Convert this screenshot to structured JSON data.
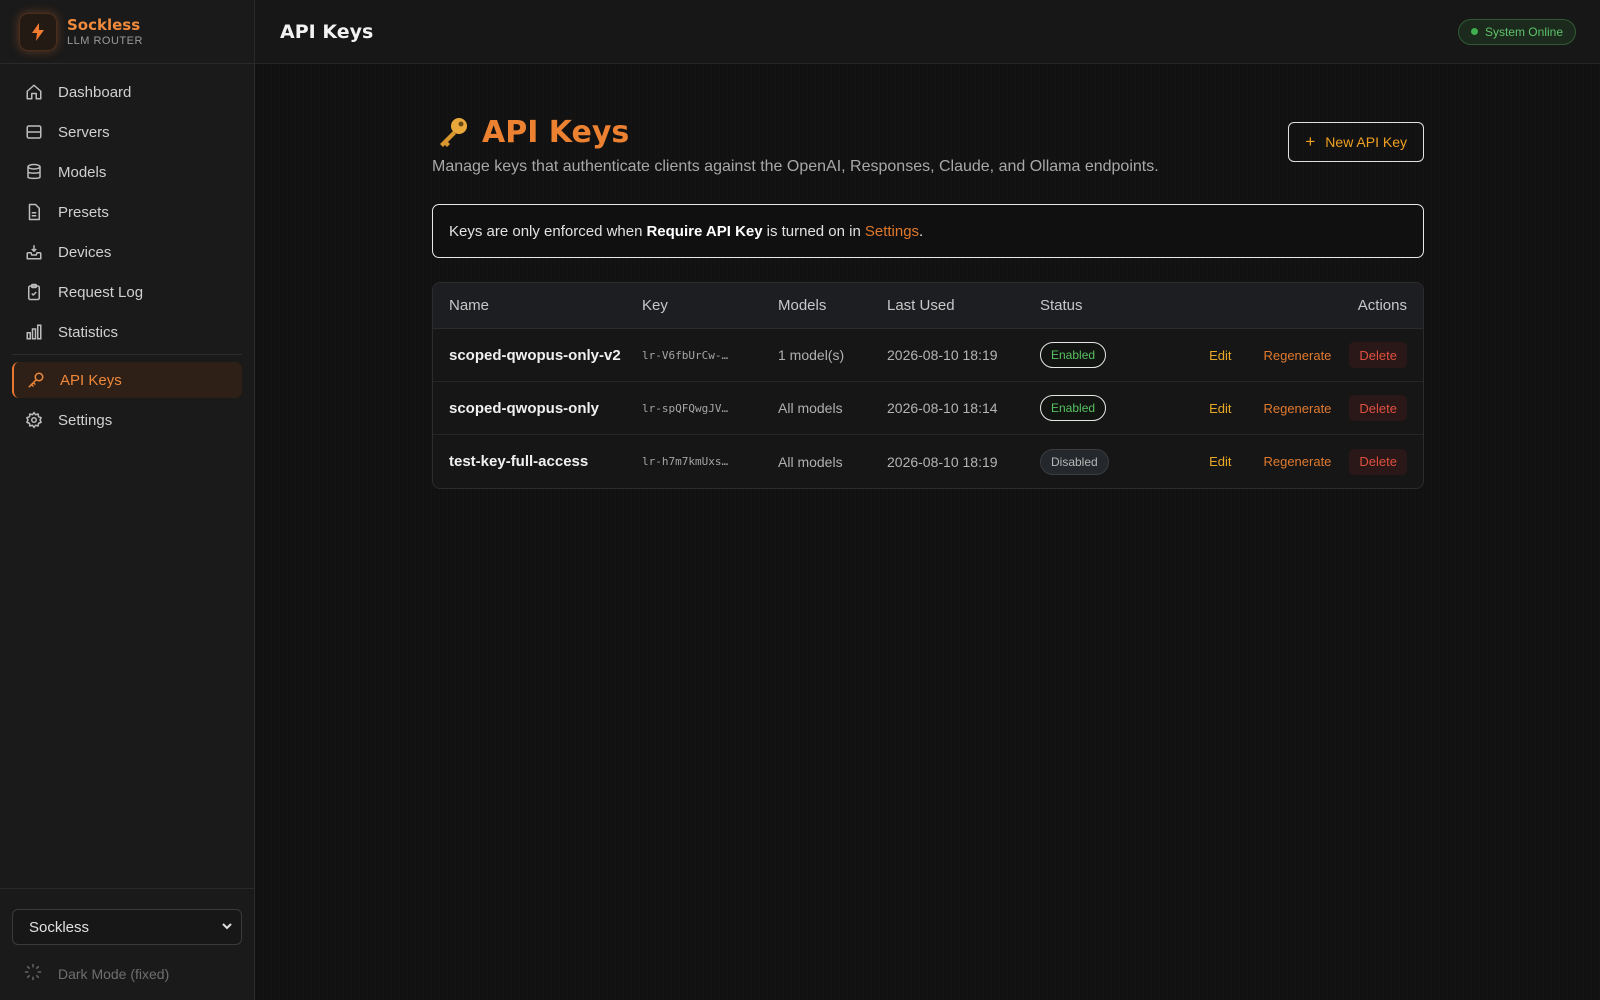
{
  "brand": {
    "name": "Sockless",
    "subtitle": "LLM ROUTER"
  },
  "sidebar": {
    "items": [
      {
        "label": "Dashboard",
        "icon": "home-icon"
      },
      {
        "label": "Servers",
        "icon": "server-icon"
      },
      {
        "label": "Models",
        "icon": "database-icon"
      },
      {
        "label": "Presets",
        "icon": "file-icon"
      },
      {
        "label": "Devices",
        "icon": "inbox-download-icon"
      },
      {
        "label": "Request Log",
        "icon": "clipboard-check-icon"
      },
      {
        "label": "Statistics",
        "icon": "bar-chart-icon"
      },
      {
        "label": "API Keys",
        "icon": "key-icon",
        "active": true
      },
      {
        "label": "Settings",
        "icon": "gear-icon"
      }
    ],
    "theme_select": {
      "value": "Sockless"
    },
    "dark_mode_label": "Dark Mode (fixed)"
  },
  "topbar": {
    "title": "API Keys",
    "status": "System Online"
  },
  "page": {
    "title": "API Keys",
    "subtitle": "Manage keys that authenticate clients against the OpenAI, Responses, Claude, and Ollama endpoints.",
    "new_button": "New API Key",
    "notice": {
      "prefix": "Keys are only enforced when",
      "bold": "Require API Key",
      "middle": "is turned on in",
      "link": "Settings",
      "suffix": "."
    }
  },
  "table": {
    "columns": {
      "name": "Name",
      "key": "Key",
      "models": "Models",
      "last_used": "Last Used",
      "status": "Status",
      "actions": "Actions"
    },
    "rows": [
      {
        "name": "scoped-qwopus-only-v2",
        "key": "lr-V6fbUrCw-…",
        "models": "1 model(s)",
        "last_used": "2026-08-10 18:19",
        "status": "Enabled"
      },
      {
        "name": "scoped-qwopus-only",
        "key": "lr-spQFQwgJV…",
        "models": "All models",
        "last_used": "2026-08-10 18:14",
        "status": "Enabled"
      },
      {
        "name": "test-key-full-access",
        "key": "lr-h7m7kmUxs…",
        "models": "All models",
        "last_used": "2026-08-10 18:19",
        "status": "Disabled"
      }
    ],
    "actions": {
      "edit": "Edit",
      "regenerate": "Regenerate",
      "delete": "Delete"
    }
  },
  "colors": {
    "accent": "#e8792f",
    "enabled": "#56c05f",
    "danger": "#e0503e",
    "warning": "#e8a825"
  }
}
